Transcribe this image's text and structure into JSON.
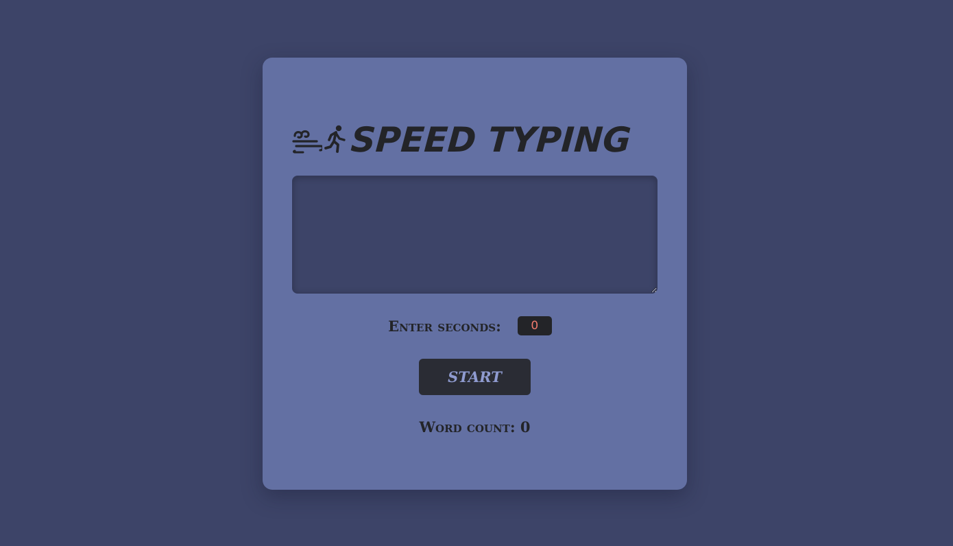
{
  "app": {
    "title": "SPEED TYPING",
    "title_icons": [
      "wind-icon",
      "runner-icon"
    ]
  },
  "typing_area": {
    "value": "",
    "placeholder": ""
  },
  "timer": {
    "label": "Enter seconds:",
    "value": "0"
  },
  "controls": {
    "start_label": "START"
  },
  "stats": {
    "word_count_label": "Word count:",
    "word_count_value": "0"
  },
  "colors": {
    "background": "#3d4468",
    "card": "#6370a3",
    "text_dark": "#232428",
    "button_bg": "#2a2c34",
    "button_text": "#8f9bd0",
    "seconds_value": "#f07a6e"
  }
}
